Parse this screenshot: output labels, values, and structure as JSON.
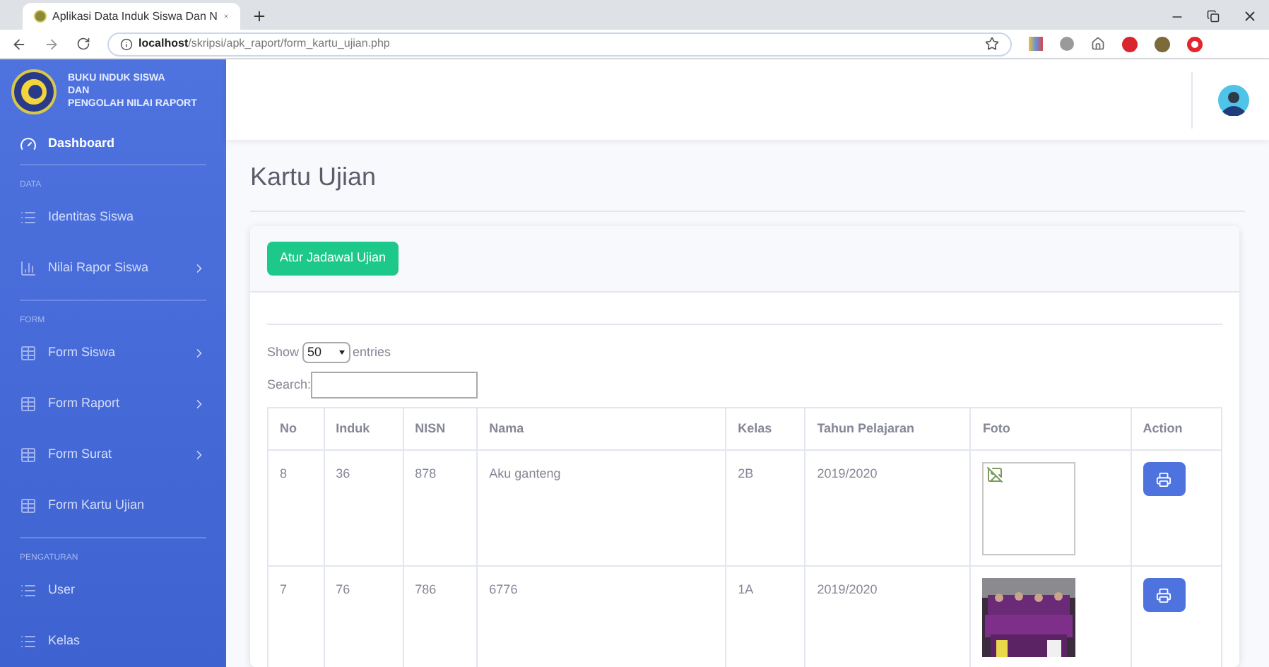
{
  "browser": {
    "tab_title": "Aplikasi Data Induk Siswa Dan N",
    "url_host": "localhost",
    "url_path": "/skripsi/apk_raport/form_kartu_ujian.php"
  },
  "sidebar": {
    "brand": [
      "BUKU INDUK SISWA",
      "DAN",
      "PENGOLAH NILAI RAPORT"
    ],
    "dashboard": {
      "label": "Dashboard",
      "selected": true
    },
    "sections": [
      {
        "heading": "DATA",
        "items": [
          {
            "label": "Identitas Siswa",
            "submenu": false
          },
          {
            "label": "Nilai Rapor Siswa",
            "submenu": true
          }
        ]
      },
      {
        "heading": "FORM",
        "items": [
          {
            "label": "Form Siswa",
            "submenu": true
          },
          {
            "label": "Form Raport",
            "submenu": true
          },
          {
            "label": "Form Surat",
            "submenu": true
          },
          {
            "label": "Form Kartu Ujian",
            "submenu": false
          }
        ]
      },
      {
        "heading": "PENGATURAN",
        "items": [
          {
            "label": "User",
            "submenu": false
          },
          {
            "label": "Kelas",
            "submenu": false
          }
        ]
      }
    ]
  },
  "page_title": "Kartu Ujian",
  "schedule_button": "Atur Jadawal Ujian",
  "table_controls": {
    "show_label": "Show",
    "entries_value": "50",
    "entries_label": "entries",
    "search_label": "Search:"
  },
  "table": {
    "columns": [
      "No",
      "Induk",
      "NISN",
      "Nama",
      "Kelas",
      "Tahun Pelajaran",
      "Foto",
      "Action"
    ],
    "rows": [
      {
        "cells": [
          "8",
          "36",
          "878",
          "Aku ganteng",
          "2B",
          "2019/2020"
        ],
        "photo": {
          "kind": "broken"
        }
      },
      {
        "cells": [
          "7",
          "76",
          "786",
          "6776",
          "1A",
          "2019/2020"
        ]
      }
    ]
  }
}
